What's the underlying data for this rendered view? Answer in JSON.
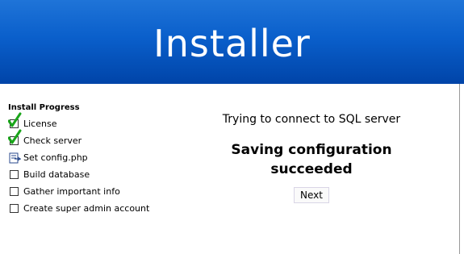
{
  "banner": {
    "title": "Installer"
  },
  "sidebar": {
    "heading": "Install Progress",
    "steps": [
      {
        "label": "License",
        "status": "done",
        "icon": "green-check-icon"
      },
      {
        "label": "Check server",
        "status": "done",
        "icon": "green-check-icon"
      },
      {
        "label": "Set config.php",
        "status": "current",
        "icon": "document-pointer-icon"
      },
      {
        "label": "Build database",
        "status": "pending",
        "icon": "empty-checkbox-icon"
      },
      {
        "label": "Gather important info",
        "status": "pending",
        "icon": "empty-checkbox-icon"
      },
      {
        "label": "Create super admin account",
        "status": "pending",
        "icon": "empty-checkbox-icon"
      }
    ]
  },
  "main": {
    "connect_text": "Trying to connect to SQL server",
    "saving_line1": "Saving configuration",
    "saving_line2": "succeeded",
    "next_label": "Next"
  },
  "colors": {
    "banner_top": "#1f74d8",
    "banner_bottom": "#0044a8",
    "check_green": "#1aa51a",
    "background": "#ffffff"
  }
}
